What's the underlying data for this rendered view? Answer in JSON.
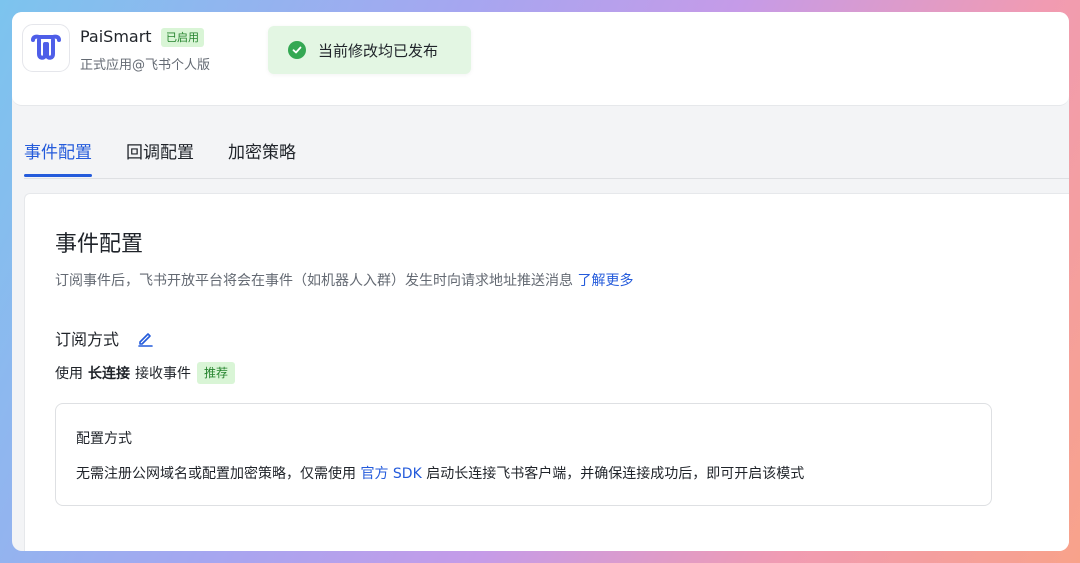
{
  "app": {
    "name": "PaiSmart",
    "status": "已启用",
    "subtitle": "正式应用@飞书个人版",
    "logo_color": "#4e5ee8"
  },
  "toast": {
    "message": "当前修改均已发布",
    "icon": "check-circle-icon",
    "color": "#34a853"
  },
  "tabs": [
    {
      "label": "事件配置",
      "active": true
    },
    {
      "label": "回调配置",
      "active": false
    },
    {
      "label": "加密策略",
      "active": false
    }
  ],
  "section": {
    "title": "事件配置",
    "description": "订阅事件后，飞书开放平台将会在事件（如机器人入群）发生时向请求地址推送消息",
    "learn_more": "了解更多"
  },
  "subscription": {
    "title": "订阅方式",
    "edit_icon": "edit-icon",
    "use_prefix": "使用",
    "method": "长连接",
    "use_suffix": "接收事件",
    "recommend_tag": "推荐"
  },
  "config_box": {
    "title": "配置方式",
    "text_before": "无需注册公网域名或配置加密策略，仅需使用",
    "sdk_link": "官方 SDK",
    "text_after": "启动长连接飞书客户端，并确保连接成功后，即可开启该模式"
  },
  "colors": {
    "accent": "#245bdb",
    "success_tag_bg": "#d9f5d6",
    "success_tag_text": "#26842e"
  }
}
